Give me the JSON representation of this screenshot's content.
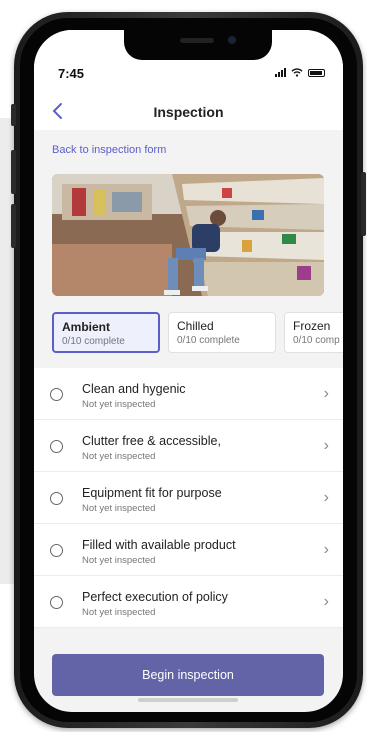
{
  "status_bar": {
    "time": "7:45"
  },
  "header": {
    "title": "Inspection",
    "back_icon": "chevron-left-icon"
  },
  "back_link": "Back to inspection form",
  "photo": {
    "description_icon": "store-aisle-photo"
  },
  "tabs": [
    {
      "label": "Ambient",
      "sub": "0/10 complete",
      "active": true
    },
    {
      "label": "Chilled",
      "sub": "0/10 complete",
      "active": false
    },
    {
      "label": "Frozen",
      "sub": "0/10 comp",
      "active": false
    }
  ],
  "checklist": [
    {
      "title": "Clean and hygenic",
      "status": "Not yet inspected"
    },
    {
      "title": "Clutter free & accessible,",
      "status": "Not yet inspected"
    },
    {
      "title": "Equipment fit for purpose",
      "status": "Not yet inspected"
    },
    {
      "title": "Filled with available product",
      "status": "Not yet inspected"
    },
    {
      "title": "Perfect execution of policy",
      "status": "Not yet inspected"
    }
  ],
  "cta": {
    "label": "Begin inspection"
  },
  "colors": {
    "accent": "#5b5fc7",
    "button": "#6264a7",
    "background": "#f3f3f3"
  }
}
